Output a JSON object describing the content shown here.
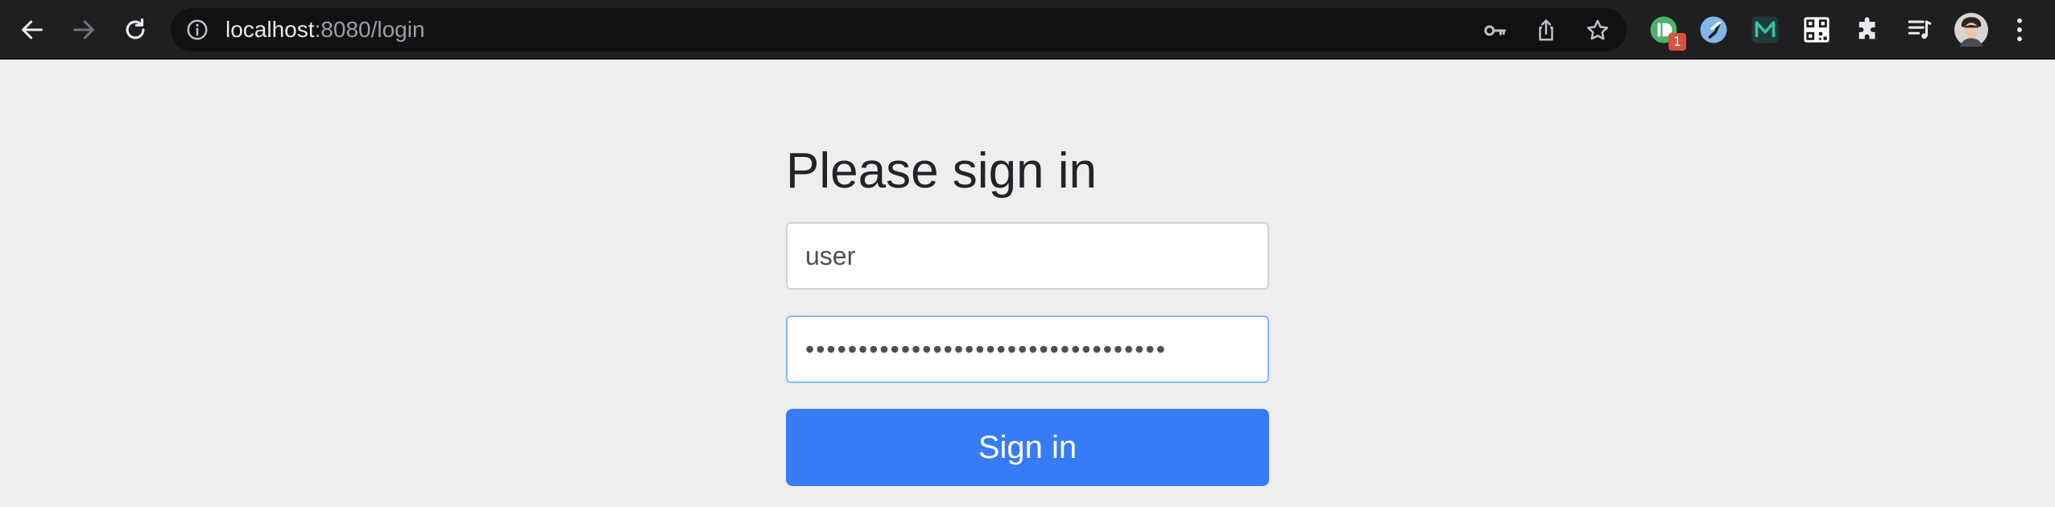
{
  "browser": {
    "url_host": "localhost",
    "url_rest": ":8080/login",
    "icons": {
      "back": "back-arrow-icon",
      "forward": "forward-arrow-icon",
      "reload": "reload-icon",
      "site_info": "info-icon",
      "password": "key-icon",
      "share": "share-icon",
      "bookmark": "star-icon",
      "extensions": "puzzle-icon",
      "media": "media-queue-icon",
      "menu": "kebab-menu-icon"
    },
    "extension_badge": "1"
  },
  "login": {
    "heading": "Please sign in",
    "username_value": "user",
    "password_value": "••••••••••••••••••••••••••••••••••",
    "submit_label": "Sign in"
  },
  "colors": {
    "toolbar_bg": "#1f1f21",
    "page_bg": "#eeeeee",
    "button_bg": "#377cf6",
    "focus_border": "#80bdff",
    "badge": "#d9503f"
  }
}
